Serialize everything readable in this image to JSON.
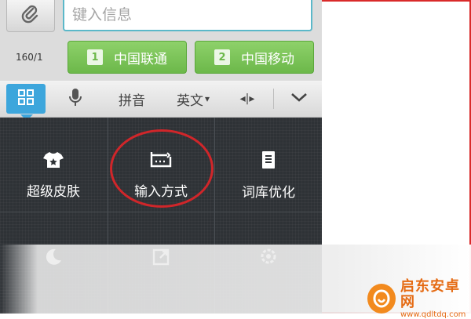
{
  "compose": {
    "placeholder": "键入信息",
    "counter": "160/1",
    "sim1": {
      "badge": "1",
      "label": "中国联通"
    },
    "sim2": {
      "badge": "2",
      "label": "中国移动"
    }
  },
  "toolbar": {
    "pinyin": "拼音",
    "english": "英文",
    "english_arrow": "▾",
    "cursor_glyph": "◂|▸"
  },
  "menu": {
    "items": [
      {
        "label": "超级皮肤",
        "icon": "shirt-icon"
      },
      {
        "label": "输入方式",
        "icon": "keyboard-input-icon"
      },
      {
        "label": "词库优化",
        "icon": "book-icon"
      },
      {
        "label": "",
        "icon": "moon-icon"
      },
      {
        "label": "",
        "icon": "window-icon"
      },
      {
        "label": "",
        "icon": "gear-icon"
      }
    ]
  },
  "watermark": {
    "title": "启东安卓网",
    "url": "www.qdltdq.com"
  },
  "colors": {
    "accent": "#3da6dc",
    "sim_green": "#6cb84a",
    "highlight": "#d0262a",
    "panel": "#2e3236"
  }
}
